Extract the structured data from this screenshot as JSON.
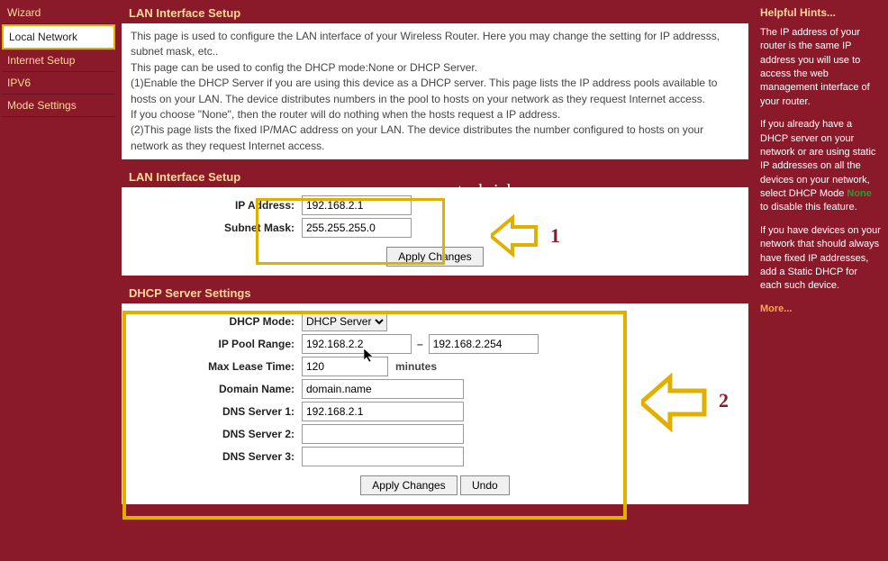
{
  "nav": {
    "items": [
      {
        "label": "Wizard"
      },
      {
        "label": "Local Network"
      },
      {
        "label": "Internet Setup"
      },
      {
        "label": "IPV6"
      },
      {
        "label": "Mode Settings"
      }
    ],
    "active_index": 1
  },
  "intro_panel": {
    "title": "LAN Interface Setup",
    "lines": [
      "This page is used to configure the LAN interface of your Wireless Router. Here you may change the setting for IP addresss, subnet mask, etc..",
      "This page can be used to config the DHCP mode:None or DHCP Server.",
      "(1)Enable the DHCP Server if you are using this device as a DHCP server. This page lists the IP address pools available to hosts on your LAN. The device distributes numbers in the pool to hosts on your network as they request Internet access.",
      "If you choose \"None\", then the router will do nothing when the hosts request a IP address.",
      "(2)This page lists the fixed IP/MAC address on your LAN. The device distributes the number configured to hosts on your network as they request Internet access."
    ]
  },
  "lan_panel": {
    "title": "LAN Interface Setup",
    "ip_label": "IP Address:",
    "ip": "192.168.2.1",
    "mask_label": "Subnet Mask:",
    "mask": "255.255.255.0",
    "apply": "Apply Changes"
  },
  "dhcp_panel": {
    "title": "DHCP Server Settings",
    "mode_label": "DHCP Mode:",
    "mode": "DHCP Server",
    "pool_label": "IP Pool Range:",
    "pool_start": "192.168.2.2",
    "pool_end": "192.168.2.254",
    "lease_label": "Max Lease Time:",
    "lease": "120",
    "lease_unit": "minutes",
    "domain_label": "Domain Name:",
    "domain": "domain.name",
    "dns1_label": "DNS Server 1:",
    "dns1": "192.168.2.1",
    "dns2_label": "DNS Server 2:",
    "dns2": "",
    "dns3_label": "DNS Server 3:",
    "dns3": "",
    "apply": "Apply Changes",
    "undo": "Undo"
  },
  "hints": {
    "title": "Helpful Hints...",
    "p1": "The IP address of your router is the same IP address you will use to access the web management interface of your router.",
    "p2a": "If you already have a DHCP server on your network or are using static IP addresses on all the devices on your network, select DHCP Mode ",
    "p2_none": "None",
    "p2b": " to disable this feature.",
    "p3": "If you have devices on your network that should always have fixed IP addresses, add a Static DHCP for each such device.",
    "more": "More..."
  },
  "annotations": {
    "watermark": "techrickszone.comm",
    "a1": "1",
    "a2": "2"
  },
  "colors": {
    "brand": "#8a1a2a",
    "accent_text": "#ffd89b",
    "highlight": "#e0b000"
  }
}
